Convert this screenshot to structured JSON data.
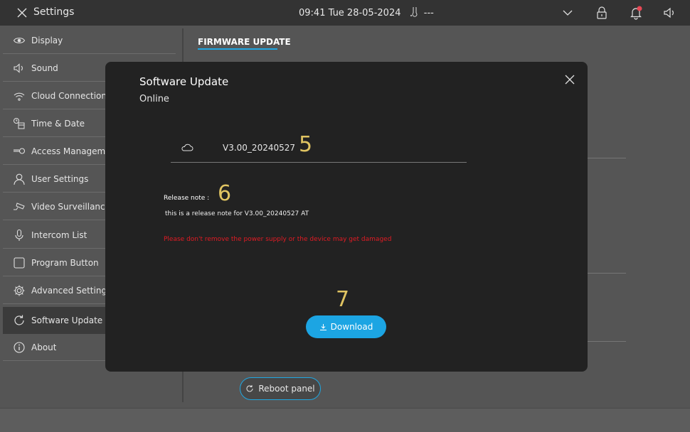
{
  "topbar": {
    "title": "Settings",
    "time_date": "09:41  Tue 28-05-2024",
    "temperature": "---"
  },
  "sidebar": {
    "items": [
      {
        "label": "Display",
        "icon": "eye-icon"
      },
      {
        "label": "Sound",
        "icon": "speaker-icon"
      },
      {
        "label": "Cloud Connections",
        "icon": "wifi-icon"
      },
      {
        "label": "Time & Date",
        "icon": "clock-calendar-icon"
      },
      {
        "label": "Access Management",
        "icon": "key-icon"
      },
      {
        "label": "User Settings",
        "icon": "user-icon"
      },
      {
        "label": "Video Surveillance",
        "icon": "camera-icon"
      },
      {
        "label": "Intercom List",
        "icon": "microphone-icon"
      },
      {
        "label": "Program Button",
        "icon": "square-icon"
      },
      {
        "label": "Advanced Settings",
        "icon": "gear-icon"
      },
      {
        "label": "Software Update",
        "icon": "refresh-icon",
        "active": true
      },
      {
        "label": "About",
        "icon": "info-icon"
      }
    ]
  },
  "content": {
    "tab": "FIRMWARE UPDATE",
    "reboot_label": "Reboot panel"
  },
  "modal": {
    "title": "Software Update",
    "subtitle": "Online",
    "version": "V3.00_20240527",
    "release_note_label": "Release note :",
    "release_note_text": "this is a release note for V3.00_20240527 AT",
    "warning": "Please don't remove the power supply or the device may get damaged",
    "download_label": "Download"
  },
  "callouts": {
    "version": "5",
    "release_note": "6",
    "download": "7"
  },
  "colors": {
    "accent": "#1ca5e3",
    "warning": "#e01b24",
    "callout": "#e0c462",
    "notification": "#e84855"
  }
}
